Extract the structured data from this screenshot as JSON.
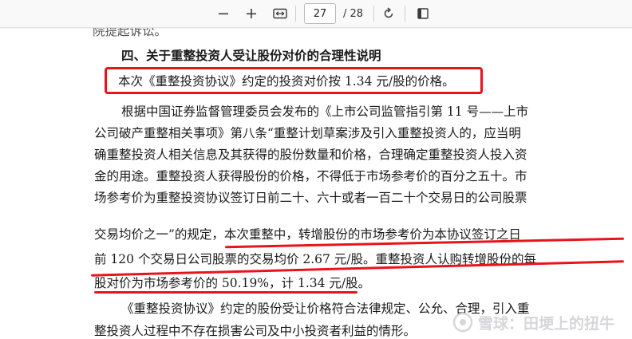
{
  "toolbar": {
    "zoom_out_icon": "minus-icon",
    "zoom_in_icon": "plus-icon",
    "fit_icon": "fit-width-icon",
    "page_number": "27",
    "page_total": "/ 28",
    "rotate_icon": "rotate-icon",
    "page_view_icon": "page-view-icon"
  },
  "document": {
    "cut_line": "院提起诉讼。",
    "heading": "四、关于重整投资人受让股份对价的合理性说明",
    "highlight": "本次《重整投资协议》约定的投资对价按 1.34 元/股的价格。",
    "para1": [
      "根据中国证券监督管理委员会发布的《上市公司监管指引第 11 号——上市",
      "公司破产重整相关事项》第八条“重整计划草案涉及引入重整投资人的，应当明",
      "确重整投资人相关信息及其获得的股份数量和价格，合理确定重整投资人投入资",
      "金的用途。重整投资人获得股份的价格，不得低于市场参考价的百分之五十。市",
      "场参考价为重整投资协议签订日前二十、六十或者一百二十个交易日的公司股票",
      "交易均价之一”的规定，本次重整中，转增股份的市场参考价为本协议签订之日",
      "前 120 个交易日公司股票的交易均价 2.67 元/股。重整投资人认购转增股份的每",
      "股对价为市场参考价的 50.19%，计 1.34 元/股。"
    ],
    "para2": [
      "《重整投资协议》约定的股份受让价格符合法律规定、公允、合理，引入重",
      "整投资人过程中不存在损害公司及中小投资者利益的情形。"
    ]
  },
  "watermark": {
    "text": "雪球：田埂上的扭牛"
  }
}
